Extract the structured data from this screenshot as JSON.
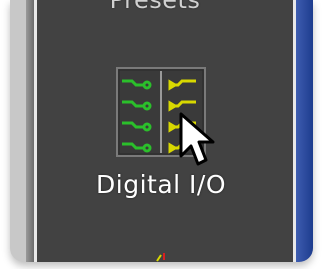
{
  "panel": {
    "section_title": "Presets"
  },
  "preset": {
    "label": "Digital I/O",
    "icon": "digital-io-icon"
  },
  "colors": {
    "panel_bg": "#424242",
    "input_green": "#2bbf2b",
    "output_yellow": "#d8d800",
    "accent_blue": "#1d3c8e"
  }
}
